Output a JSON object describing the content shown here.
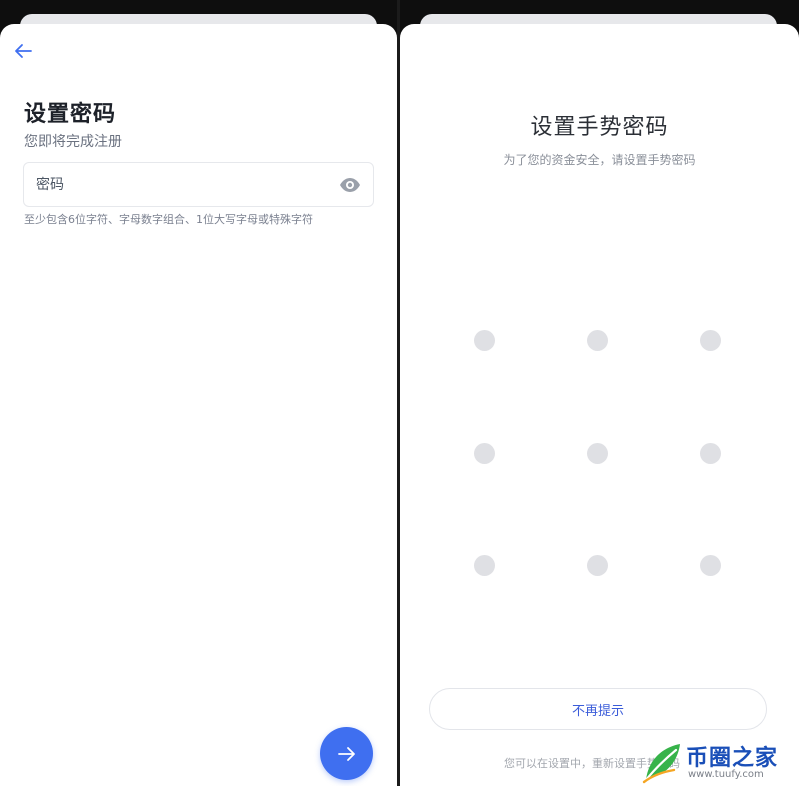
{
  "left": {
    "title": "设置密码",
    "subtitle": "您即将完成注册",
    "password_placeholder": "密码",
    "hint": "至少包含6位字符、字母数字组合、1位大写字母或特殊字符",
    "icons": {
      "back": "arrow-left-icon",
      "eye": "eye-icon",
      "next": "arrow-right-icon"
    },
    "colors": {
      "accent": "#3f6ff0",
      "title": "#1d2129"
    }
  },
  "right": {
    "title": "设置手势密码",
    "subtitle": "为了您的资金安全，请设置手势密码",
    "gesture_grid": {
      "rows": 3,
      "cols": 3
    },
    "skip_label": "不再提示",
    "footer_note": "您可以在设置中，重新设置手势密码",
    "colors": {
      "dot": "#dfe0e4",
      "link": "#3b5cd9"
    }
  },
  "watermark": {
    "brand": "币圈之家",
    "url": "www.tuufy.com"
  }
}
